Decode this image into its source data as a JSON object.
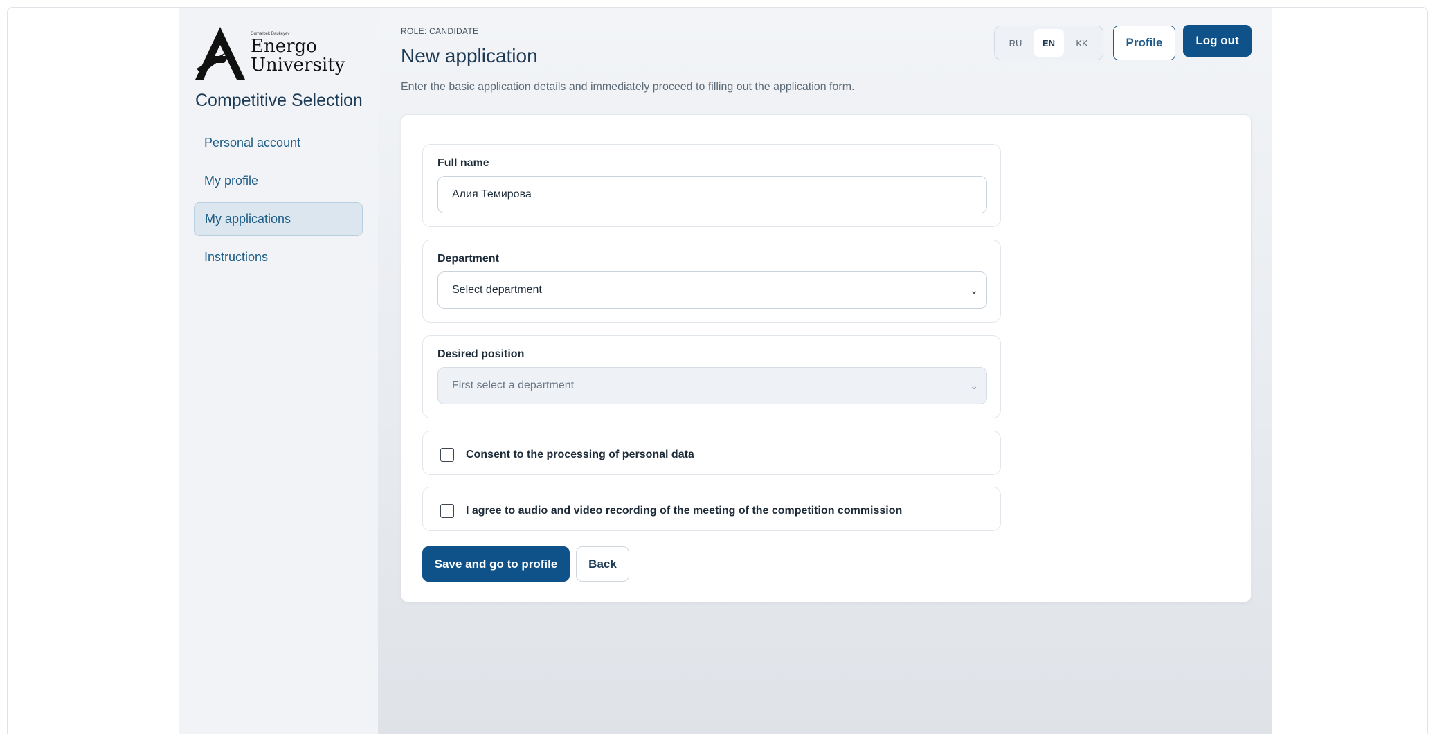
{
  "logo": {
    "small_text": "Gumarbek Daukeyev",
    "line1": "Energo",
    "line2": "University"
  },
  "sidebar": {
    "title": "Competitive Selection",
    "items": [
      {
        "label": "Personal account"
      },
      {
        "label": "My profile"
      },
      {
        "label": "My applications",
        "active": true
      },
      {
        "label": "Instructions"
      }
    ]
  },
  "header": {
    "role": "ROLE: CANDIDATE",
    "title": "New application",
    "subtitle": "Enter the basic application details and immediately proceed to filling out the application form."
  },
  "languages": {
    "items": [
      "RU",
      "EN",
      "KK"
    ],
    "active": "EN"
  },
  "buttons": {
    "profile": "Profile",
    "logout": "Log out",
    "save": "Save and go to profile",
    "back": "Back"
  },
  "form": {
    "full_name": {
      "label": "Full name",
      "value": "Алия Темирова"
    },
    "department": {
      "label": "Department",
      "value": "Select department"
    },
    "position": {
      "label": "Desired position",
      "value": "First select a department"
    },
    "consent_personal": {
      "label": "Consent to the processing of personal data",
      "checked": false
    },
    "consent_recording": {
      "label": "I agree to audio and video recording of the meeting of the competition commission",
      "checked": false
    }
  },
  "colors": {
    "primary": "#0e5289",
    "sidebar_bg": "#f1f3f6",
    "active_nav_bg": "#dbe6ef",
    "link": "#1e5d86"
  },
  "icons": [
    "energo-university-logo",
    "chevron-down-icon"
  ]
}
